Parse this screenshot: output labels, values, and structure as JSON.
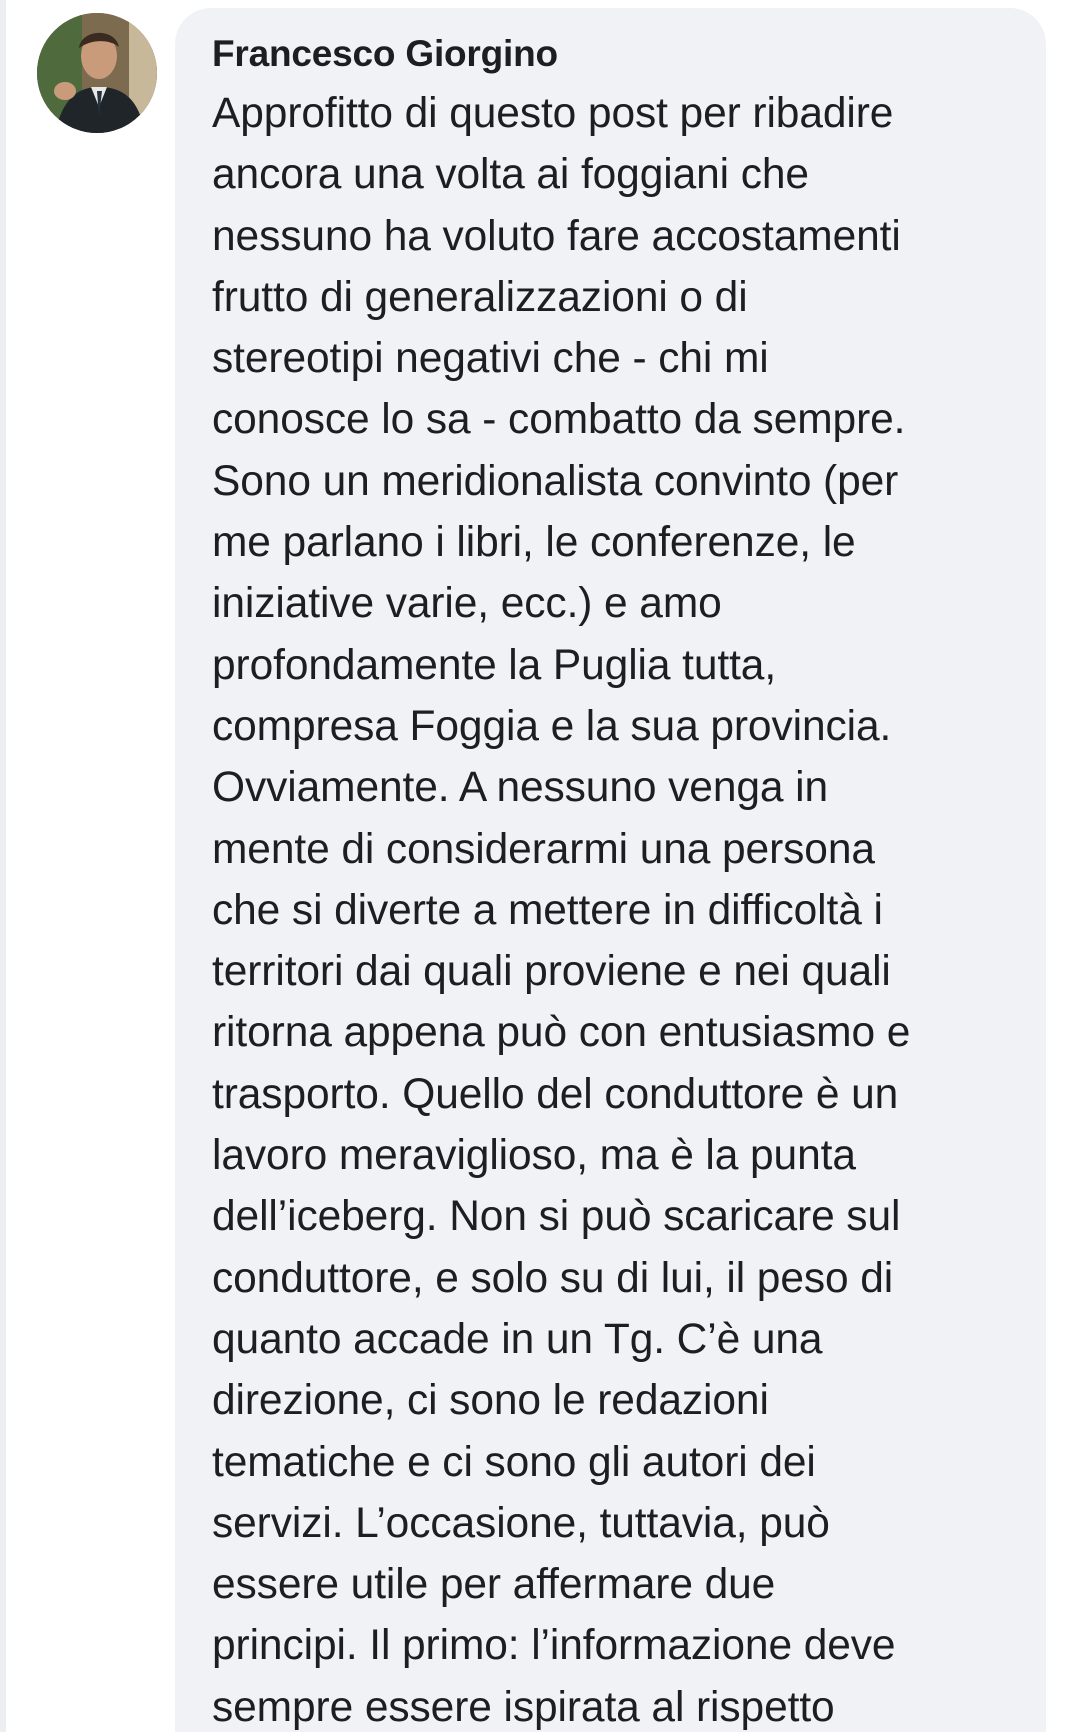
{
  "comment": {
    "author": "Francesco Giorgino",
    "avatar_icon": "profile-photo",
    "colors": {
      "bubble_background": "#f0f2f5",
      "text": "#1c1e21",
      "page_background": "#ffffff"
    },
    "lines": [
      "Approfitto di questo post per ribadire",
      "ancora una volta ai foggiani che",
      "nessuno ha voluto fare accostamenti",
      "frutto di generalizzazioni o di",
      "stereotipi negativi che - chi mi",
      "conosce lo sa - combatto da sempre.",
      "Sono un meridionalista convinto (per",
      "me parlano i libri, le conferenze, le",
      "iniziative varie, ecc.) e amo",
      "profondamente la Puglia tutta,",
      "compresa Foggia e la sua provincia.",
      "Ovviamente. A nessuno venga in",
      "mente di considerarmi una persona",
      "che si diverte a mettere in difficoltà i",
      "territori dai quali proviene e nei quali",
      "ritorna appena può con entusiasmo e",
      "trasporto. Quello del conduttore è un",
      "lavoro meraviglioso, ma è la punta",
      "dell’iceberg. Non si può scaricare sul",
      "conduttore, e solo su di lui, il peso di",
      "quanto accade in un Tg. C’è una",
      "direzione, ci sono le redazioni",
      "tematiche e ci sono gli autori dei",
      "servizi. L’occasione, tuttavia, può",
      "essere utile per affermare due",
      "principi. Il primo: l’informazione deve",
      "sempre essere ispirata al rispetto"
    ]
  }
}
